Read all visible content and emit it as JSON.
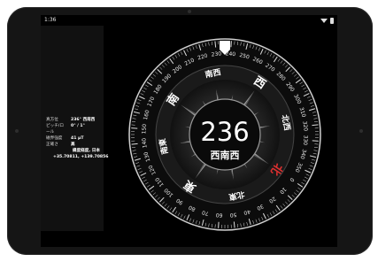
{
  "status": {
    "time": "1:36",
    "icons": [
      "wifi-icon",
      "battery-icon"
    ]
  },
  "info_panel": {
    "rows": [
      {
        "label": "真方位",
        "value": "236° 西南西"
      },
      {
        "label": "ピッチ/ロール",
        "value": "0° / 1°"
      },
      {
        "label": "磁界強度",
        "value": "41 µT"
      },
      {
        "label": "正確さ",
        "value": "高"
      }
    ],
    "location_label": "緯度経度, 日本",
    "latlng": "+35.70811, +139.70856"
  },
  "compass": {
    "heading": "236",
    "direction": "西南西",
    "ring_labels": [
      "北",
      "北東",
      "東",
      "南東",
      "南",
      "南西",
      "西",
      "北西"
    ],
    "degree_ticks": [
      "0",
      "10",
      "20",
      "30",
      "40",
      "50",
      "60",
      "70",
      "80",
      "90",
      "100",
      "110",
      "120",
      "130",
      "140",
      "150",
      "160",
      "170",
      "180",
      "190",
      "200",
      "210",
      "220",
      "230",
      "240",
      "250",
      "260",
      "270",
      "280",
      "290",
      "300",
      "310",
      "320",
      "330",
      "340",
      "350"
    ],
    "accent_color": "#e03030"
  }
}
